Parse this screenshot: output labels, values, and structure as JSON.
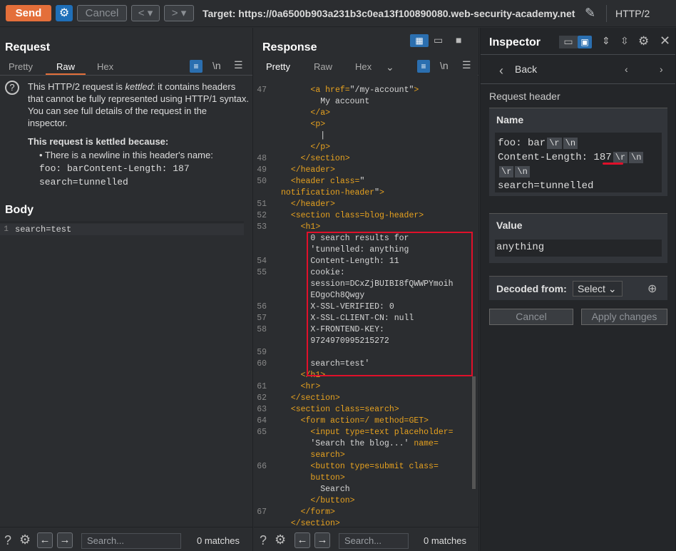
{
  "toolbar": {
    "send": "Send",
    "cancel": "Cancel",
    "back": "<",
    "forward": ">",
    "dropdown": "▾",
    "target": "Target: https://0a6500b903a231b3c0ea13f100890080.web-security-academy.net",
    "protocol": "HTTP/2",
    "gear": "⚙",
    "pencil": "✎",
    "close": "✕"
  },
  "request": {
    "title": "Request",
    "tabs": [
      "Pretty",
      "Raw",
      "Hex"
    ],
    "activeTab": "Raw",
    "warning": "?",
    "message_parts": [
      "This HTTP/2 request is ",
      "kettled",
      ": it contains headers that cannot be fully represented using HTTP/1 syntax. You can see full details of the request in the inspector."
    ],
    "reason_title": "This request is kettled because:",
    "reason_item": "• There is a newline in this header's name:",
    "reason_code": [
      "foo: barContent-Length: 187",
      "search=tunnelled"
    ],
    "body_title": "Body",
    "body_lines": [
      {
        "n": "1",
        "text": "search=test"
      }
    ],
    "search_placeholder": "Search...",
    "matches": "0 matches"
  },
  "response": {
    "title": "Response",
    "tabs": [
      "Pretty",
      "Raw",
      "Hex"
    ],
    "activeTab": "Pretty",
    "search_placeholder": "Search...",
    "matches": "0 matches",
    "lines": [
      {
        "n": "",
        "html": "      </p>"
      },
      {
        "n": "47",
        "html": "      <span class='tag'>&lt;a</span> <span class='attr'>href=</span>\"/my-account\"<span class='tag'>&gt;</span>"
      },
      {
        "n": "",
        "html": "        My account"
      },
      {
        "n": "",
        "html": "      <span class='tag'>&lt;/a&gt;</span>"
      },
      {
        "n": "",
        "html": "      <span class='tag'>&lt;p&gt;</span>"
      },
      {
        "n": "",
        "html": "        |"
      },
      {
        "n": "",
        "html": "      <span class='tag'>&lt;/p&gt;</span>"
      },
      {
        "n": "48",
        "html": "    <span class='tag'>&lt;/section&gt;</span>"
      },
      {
        "n": "49",
        "html": "  <span class='tag'>&lt;/header&gt;</span>"
      },
      {
        "n": "50",
        "html": "  <span class='tag'>&lt;header</span> <span class='attr'>class=</span>\""
      },
      {
        "n": "",
        "html": "<span class='attr'>notification-header</span>\"<span class='tag'>&gt;</span>"
      },
      {
        "n": "51",
        "html": "  <span class='tag'>&lt;/header&gt;</span>"
      },
      {
        "n": "52",
        "html": "  <span class='tag'>&lt;section</span> <span class='attr'>class=blog-header</span><span class='tag'>&gt;</span>"
      },
      {
        "n": "53",
        "html": "    <span class='tag'>&lt;h1&gt;</span>"
      },
      {
        "n": "",
        "html": "      0 search results for"
      },
      {
        "n": "",
        "html": "      'tunnelled: anything"
      },
      {
        "n": "54",
        "html": "      Content-Length: 11"
      },
      {
        "n": "55",
        "html": "      cookie:"
      },
      {
        "n": "",
        "html": "      session=DCxZjBUIBI8fQWWPYmoih"
      },
      {
        "n": "",
        "html": "      EOgoCh8Qwgy"
      },
      {
        "n": "56",
        "html": "      X-SSL-VERIFIED: 0"
      },
      {
        "n": "57",
        "html": "      X-SSL-CLIENT-CN: null"
      },
      {
        "n": "58",
        "html": "      X-FRONTEND-KEY:"
      },
      {
        "n": "",
        "html": "      9724970995215272"
      },
      {
        "n": "59",
        "html": ""
      },
      {
        "n": "60",
        "html": "      search=test'"
      },
      {
        "n": "",
        "html": "    <span class='tag'>&lt;/h1&gt;</span>"
      },
      {
        "n": "61",
        "html": "    <span class='tag'>&lt;hr&gt;</span>"
      },
      {
        "n": "62",
        "html": "  <span class='tag'>&lt;/section&gt;</span>"
      },
      {
        "n": "63",
        "html": "  <span class='tag'>&lt;section</span> <span class='attr'>class=search</span><span class='tag'>&gt;</span>"
      },
      {
        "n": "64",
        "html": "    <span class='tag'>&lt;form</span> <span class='attr'>action=/ method=GET</span><span class='tag'>&gt;</span>"
      },
      {
        "n": "65",
        "html": "      <span class='tag'>&lt;input</span> <span class='attr'>type=text placeholder=</span>"
      },
      {
        "n": "",
        "html": "      'Search the blog...' <span class='attr'>name=</span>"
      },
      {
        "n": "",
        "html": "      <span class='attr'>search</span><span class='tag'>&gt;</span>"
      },
      {
        "n": "66",
        "html": "      <span class='tag'>&lt;button</span> <span class='attr'>type=submit class=</span>"
      },
      {
        "n": "",
        "html": "      <span class='attr'>button</span><span class='tag'>&gt;</span>"
      },
      {
        "n": "",
        "html": "        Search"
      },
      {
        "n": "",
        "html": "      <span class='tag'>&lt;/button&gt;</span>"
      },
      {
        "n": "67",
        "html": "    <span class='tag'>&lt;/form&gt;</span>"
      },
      {
        "n": "",
        "html": "  <span class='tag'>&lt;/section&gt;</span>"
      }
    ]
  },
  "inspector": {
    "title": "Inspector",
    "back": "Back",
    "request_header": "Request header",
    "name_title": "Name",
    "name_lines": [
      "foo: bar",
      "Content-Length: 187",
      "",
      "search=tunnelled"
    ],
    "value_title": "Value",
    "value": "anything",
    "decoded_from": "Decoded from:",
    "select": "Select",
    "cancel": "Cancel",
    "apply": "Apply changes"
  }
}
